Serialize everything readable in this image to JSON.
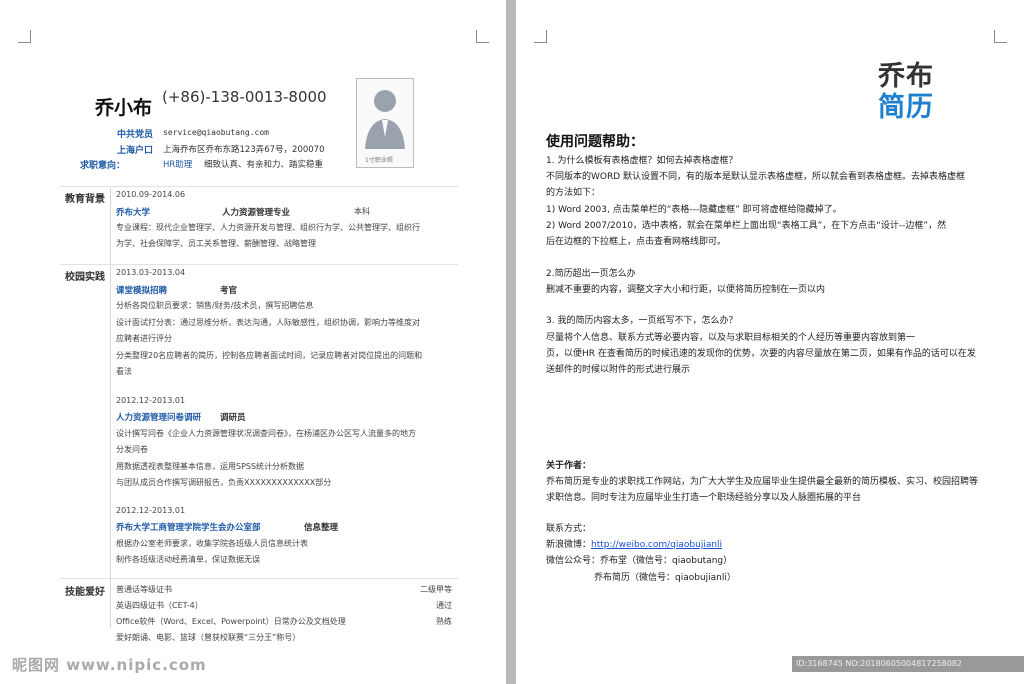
{
  "resume": {
    "name": "乔小布",
    "phone": "(+86)-138-0013-8000",
    "info_labels": [
      "中共党员",
      "上海户口",
      "求职意向："
    ],
    "email": "service@qiaobutang.com",
    "address": "上海乔布区乔布东路123弄67号，200070",
    "intent_job": "HR助理",
    "intent_traits": "细致认真、有亲和力、踏实稳重",
    "photo_caption": "1寸职业照",
    "education": {
      "title": "教育背景",
      "date": "2010.09-2014.06",
      "school": "乔布大学",
      "major": "人力资源管理专业",
      "degree": "本科",
      "courses_1": "专业课程：现代企业管理学、人力资源开发与管理、组织行为学、公共管理学、组织行",
      "courses_2": "为学、社会保障学、员工关系管理、薪酬管理、战略管理"
    },
    "campus": {
      "title": "校园实践",
      "exp1": {
        "date": "2013.03-2013.04",
        "org": "课堂模拟招聘",
        "role": "考官",
        "lines": [
          "分析各岗位职员要求：销售/财务/技术员，撰写招聘信息",
          "设计面试打分表：通过思维分析，表达沟通，人际敏感性，组织协调，影响力等维度对",
          "应聘者进行评分",
          "分类整理20名应聘者的简历，控制各应聘者面试时间，记录应聘者对岗位提出的问题和",
          "看法"
        ]
      },
      "exp2": {
        "date": "2012.12-2013.01",
        "org": "人力资源管理问卷调研",
        "role": "调研员",
        "lines": [
          "设计撰写问卷《企业人力资源管理状况调查问卷》，在杨浦区办公区写人流量多的地方",
          "分发问卷",
          "用数据透视表整理基本信息，运用SPSS统计分析数据",
          "与团队成员合作撰写调研报告，负责XXXXXXXXXXXXX部分"
        ]
      },
      "exp3": {
        "date": "2012.12-2013.01",
        "org": "乔布大学工商管理学院学生会办公室部",
        "role": "信息整理",
        "lines": [
          "根据办公室老师要求，收集学院各班级人员信息统计表",
          "制作各班级活动经费清单，保证数据无误"
        ]
      }
    },
    "skills": {
      "title": "技能爱好",
      "rows": [
        {
          "text": "普通话等级证书",
          "level": "二级甲等"
        },
        {
          "text": "英语四级证书（CET-4）",
          "level": "通过"
        },
        {
          "text": "Office软件（Word、Excel、Powerpoint）日常办公及文档处理",
          "level": "熟练"
        },
        {
          "text": "爱好朗诵、电影、篮球（曾获校联赛“三分王”称号）",
          "level": ""
        }
      ]
    }
  },
  "help": {
    "logo_line1": "乔布",
    "logo_line2": "简历",
    "title": "使用问题帮助：",
    "q1": "1. 为什么模板有表格虚框？如何去掉表格虚框？",
    "a1_lines": [
      "不同版本的WORD 默认设置不同，有的版本是默认显示表格虚框，所以就会看到表格虚框。去掉表格虚框",
      "的方法如下：",
      "1) Word 2003, 点击菜单栏的“表格---隐藏虚框” 即可将虚框给隐藏掉了。",
      "2) Word 2007/2010，选中表格，就会在菜单栏上面出现“表格工具”，在下方点击“设计--边框”，然",
      "后在边框的下拉框上，点击查看网格线即可。"
    ],
    "q2": "2.简历超出一页怎么办",
    "a2": "删减不重要的内容，调整文字大小和行距，以便将简历控制在一页以内",
    "q3": "3. 我的简历内容太多，一页纸写不下，怎么办？",
    "a3_lines": [
      "尽量将个人信息、联系方式等必要内容，以及与求职目标相关的个人经历等重要内容放到第一",
      "页，以便HR 在查看简历的时候迅速的发现你的优势，次要的内容尽量放在第二页，如果有作品的话可以在发",
      "送邮件的时候以附件的形式进行展示"
    ],
    "about_title": "关于作者：",
    "about_lines": [
      "乔布简历是专业的求职找工作网站，为广大大学生及应届毕业生提供最全最新的简历模板、实习、校园招聘等",
      "求职信息。同时专注为应届毕业生打造一个职场经验分享以及人脉圈拓展的平台"
    ],
    "contact_title": "联系方式：",
    "weibo_label": "新浪微博：",
    "weibo_link": "http://weibo.com/qiaobujianli",
    "wechat1": "微信公众号：乔布堂（微信号：qiaobutang）",
    "wechat2": "乔布简历（微信号：qiaobujianli）"
  },
  "overlay": {
    "watermark": "昵图网 www.nipic.com",
    "id_text": "ID:3168745 NO:20180605004817258082"
  },
  "colors": {
    "accent_blue": "#1f5aa6",
    "logo_blue": "#1e7fd0",
    "logo_dark": "#333333"
  }
}
